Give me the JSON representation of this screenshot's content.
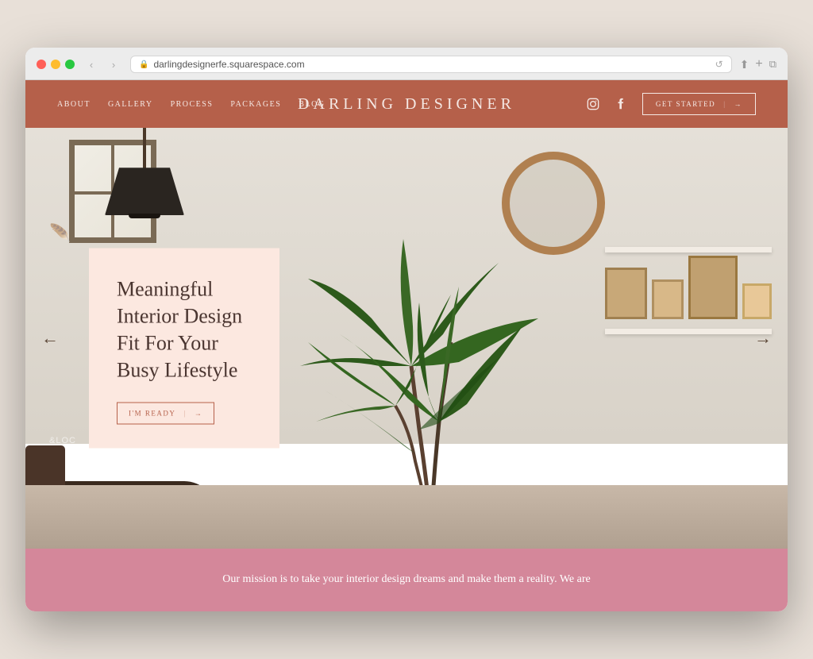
{
  "browser": {
    "url": "darlingdesignerfe.squarespace.com",
    "nav_back": "‹",
    "nav_forward": "›",
    "refresh": "↺",
    "share": "⬆",
    "new_tab": "+",
    "windows": "⧉"
  },
  "header": {
    "nav_items": [
      "ABOUT",
      "GALLERY",
      "PROCESS",
      "PACKAGES",
      "BLOG"
    ],
    "logo": "DARLING DESIGNER",
    "instagram_label": "instagram-icon",
    "facebook_label": "facebook-icon",
    "cta_label": "GET STARTED",
    "cta_arrow": "→"
  },
  "hero": {
    "headline": "Meaningful Interior Design Fit For Your Busy Lifestyle",
    "cta_label": "I'M READY",
    "cta_arrow": "→",
    "arrow_left": "←",
    "arrow_right": "→"
  },
  "mission": {
    "text": "Our mission is to take your interior design dreams and make them a reality. We are"
  },
  "colors": {
    "header_bg": "#b5604a",
    "hero_text_bg": "#fce8e0",
    "mission_bg": "#d4879a",
    "cta_border": "#b5604a",
    "headline_color": "#4a3530"
  }
}
